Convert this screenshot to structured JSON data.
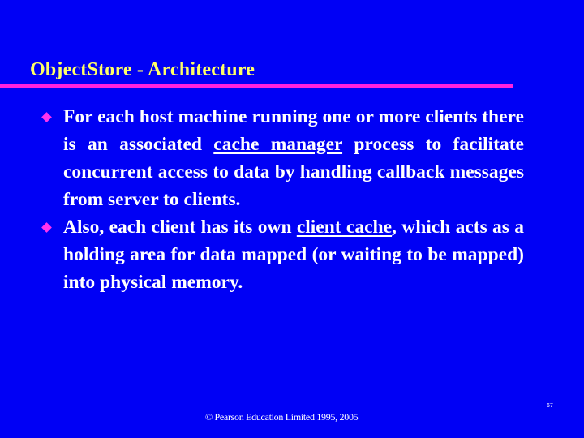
{
  "slide": {
    "title": "ObjectStore - Architecture",
    "bullets": [
      {
        "parts": [
          {
            "text": "For each host machine running one or more clients there is an associated ",
            "underline": false
          },
          {
            "text": "cache manager",
            "underline": true
          },
          {
            "text": " process to facilitate concurrent access to data by handling callback messages from server to clients.",
            "underline": false
          }
        ]
      },
      {
        "parts": [
          {
            "text": "Also, each client has its own ",
            "underline": false
          },
          {
            "text": "client cache",
            "underline": true
          },
          {
            "text": ", which acts as a holding area for data mapped (or waiting to be mapped) into physical memory.",
            "underline": false
          }
        ]
      }
    ],
    "bullet_icon": "diamond-bullet-icon",
    "footer": "© Pearson Education Limited 1995, 2005",
    "page_number": "67"
  },
  "colors": {
    "background": "#0000f5",
    "title": "#ffff66",
    "rule": "#ff22dd",
    "bullet_marker": "#ff33ee",
    "text": "#ffffff"
  }
}
